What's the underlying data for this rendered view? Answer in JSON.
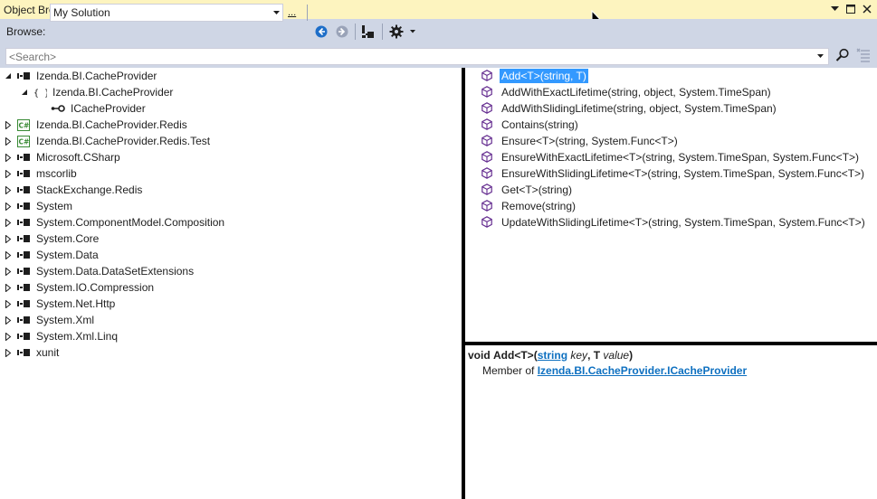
{
  "window": {
    "title": "Object Browser"
  },
  "toolbar": {
    "browse_label": "Browse:",
    "browse_value": "My Solution",
    "ellipsis_label": "..."
  },
  "search": {
    "placeholder": "<Search>"
  },
  "colors": {
    "titlebar": "#fdf4bf",
    "toolbar": "#cfd6e5",
    "selection": "#3399ff",
    "link": "#0e70c0",
    "back_button": "#1e6ec8"
  },
  "tree": {
    "items": [
      {
        "label": "Izenda.BI.CacheProvider",
        "level": 0,
        "expanded": true,
        "icon": "assembly-icon"
      },
      {
        "label": "Izenda.BI.CacheProvider",
        "level": 1,
        "expanded": true,
        "icon": "namespace-icon"
      },
      {
        "label": "ICacheProvider",
        "level": 2,
        "expanded": false,
        "icon": "interface-icon",
        "leaf": true
      },
      {
        "label": "Izenda.BI.CacheProvider.Redis",
        "level": 0,
        "expanded": false,
        "icon": "csharp-project-icon"
      },
      {
        "label": "Izenda.BI.CacheProvider.Redis.Test",
        "level": 0,
        "expanded": false,
        "icon": "csharp-project-icon"
      },
      {
        "label": "Microsoft.CSharp",
        "level": 0,
        "expanded": false,
        "icon": "assembly-icon"
      },
      {
        "label": "mscorlib",
        "level": 0,
        "expanded": false,
        "icon": "assembly-icon"
      },
      {
        "label": "StackExchange.Redis",
        "level": 0,
        "expanded": false,
        "icon": "assembly-icon"
      },
      {
        "label": "System",
        "level": 0,
        "expanded": false,
        "icon": "assembly-icon"
      },
      {
        "label": "System.ComponentModel.Composition",
        "level": 0,
        "expanded": false,
        "icon": "assembly-icon"
      },
      {
        "label": "System.Core",
        "level": 0,
        "expanded": false,
        "icon": "assembly-icon"
      },
      {
        "label": "System.Data",
        "level": 0,
        "expanded": false,
        "icon": "assembly-icon"
      },
      {
        "label": "System.Data.DataSetExtensions",
        "level": 0,
        "expanded": false,
        "icon": "assembly-icon"
      },
      {
        "label": "System.IO.Compression",
        "level": 0,
        "expanded": false,
        "icon": "assembly-icon"
      },
      {
        "label": "System.Net.Http",
        "level": 0,
        "expanded": false,
        "icon": "assembly-icon"
      },
      {
        "label": "System.Xml",
        "level": 0,
        "expanded": false,
        "icon": "assembly-icon"
      },
      {
        "label": "System.Xml.Linq",
        "level": 0,
        "expanded": false,
        "icon": "assembly-icon"
      },
      {
        "label": "xunit",
        "level": 0,
        "expanded": false,
        "icon": "assembly-icon"
      }
    ]
  },
  "members": {
    "items": [
      {
        "label": "Add<T>(string, T)",
        "selected": true
      },
      {
        "label": "AddWithExactLifetime(string, object, System.TimeSpan)",
        "selected": false
      },
      {
        "label": "AddWithSlidingLifetime(string, object, System.TimeSpan)",
        "selected": false
      },
      {
        "label": "Contains(string)",
        "selected": false
      },
      {
        "label": "Ensure<T>(string, System.Func<T>)",
        "selected": false
      },
      {
        "label": "EnsureWithExactLifetime<T>(string, System.TimeSpan, System.Func<T>)",
        "selected": false
      },
      {
        "label": "EnsureWithSlidingLifetime<T>(string, System.TimeSpan, System.Func<T>)",
        "selected": false
      },
      {
        "label": "Get<T>(string)",
        "selected": false
      },
      {
        "label": "Remove(string)",
        "selected": false
      },
      {
        "label": "UpdateWithSlidingLifetime<T>(string, System.TimeSpan, System.Func<T>)",
        "selected": false
      }
    ]
  },
  "description": {
    "return_type": "void",
    "method_name": "Add<T>(",
    "param1_type": "string",
    "param1_name": "key",
    "comma": ", ",
    "param2_type": "T",
    "param2_name": "value",
    "close": ")",
    "member_of_label": "Member of",
    "namespace_link": "Izenda.BI.CacheProvider",
    "dot": ".",
    "type_link": "ICacheProvider"
  }
}
